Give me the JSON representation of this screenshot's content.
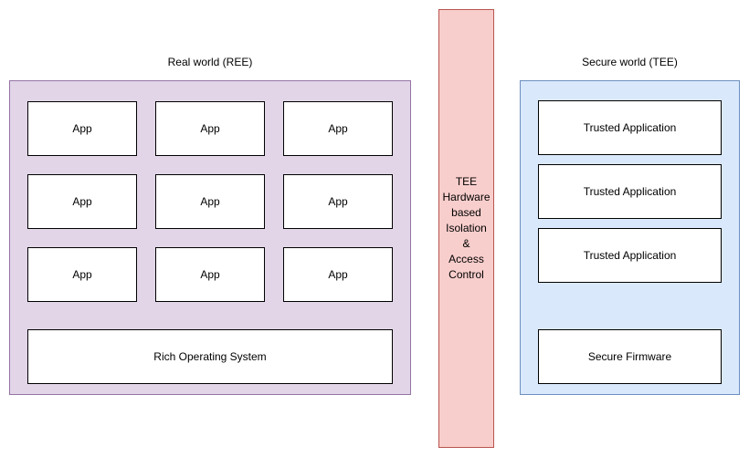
{
  "diagram": {
    "title_ree": "Real world (REE)",
    "title_tee": "Secure world (TEE)",
    "isolation_label": "TEE\nHardware\nbased\nIsolation\n&\nAccess\nControl",
    "colors": {
      "ree_fill": "#e1d5e7",
      "ree_stroke": "#9673a6",
      "tee_fill": "#dae8fc",
      "tee_stroke": "#6c8ebf",
      "isolation_fill": "#f8cecc",
      "isolation_stroke": "#b85450",
      "node_fill": "#ffffff",
      "node_stroke": "#000000",
      "text": "#000000",
      "background": "#ffffff"
    },
    "ree": {
      "apps": [
        {
          "label": "App"
        },
        {
          "label": "App"
        },
        {
          "label": "App"
        },
        {
          "label": "App"
        },
        {
          "label": "App"
        },
        {
          "label": "App"
        },
        {
          "label": "App"
        },
        {
          "label": "App"
        },
        {
          "label": "App"
        }
      ],
      "os": {
        "label": "Rich Operating System"
      }
    },
    "tee": {
      "trusted_apps": [
        {
          "label": "Trusted Application"
        },
        {
          "label": "Trusted Application"
        },
        {
          "label": "Trusted Application"
        }
      ],
      "firmware": {
        "label": "Secure Firmware"
      }
    }
  }
}
